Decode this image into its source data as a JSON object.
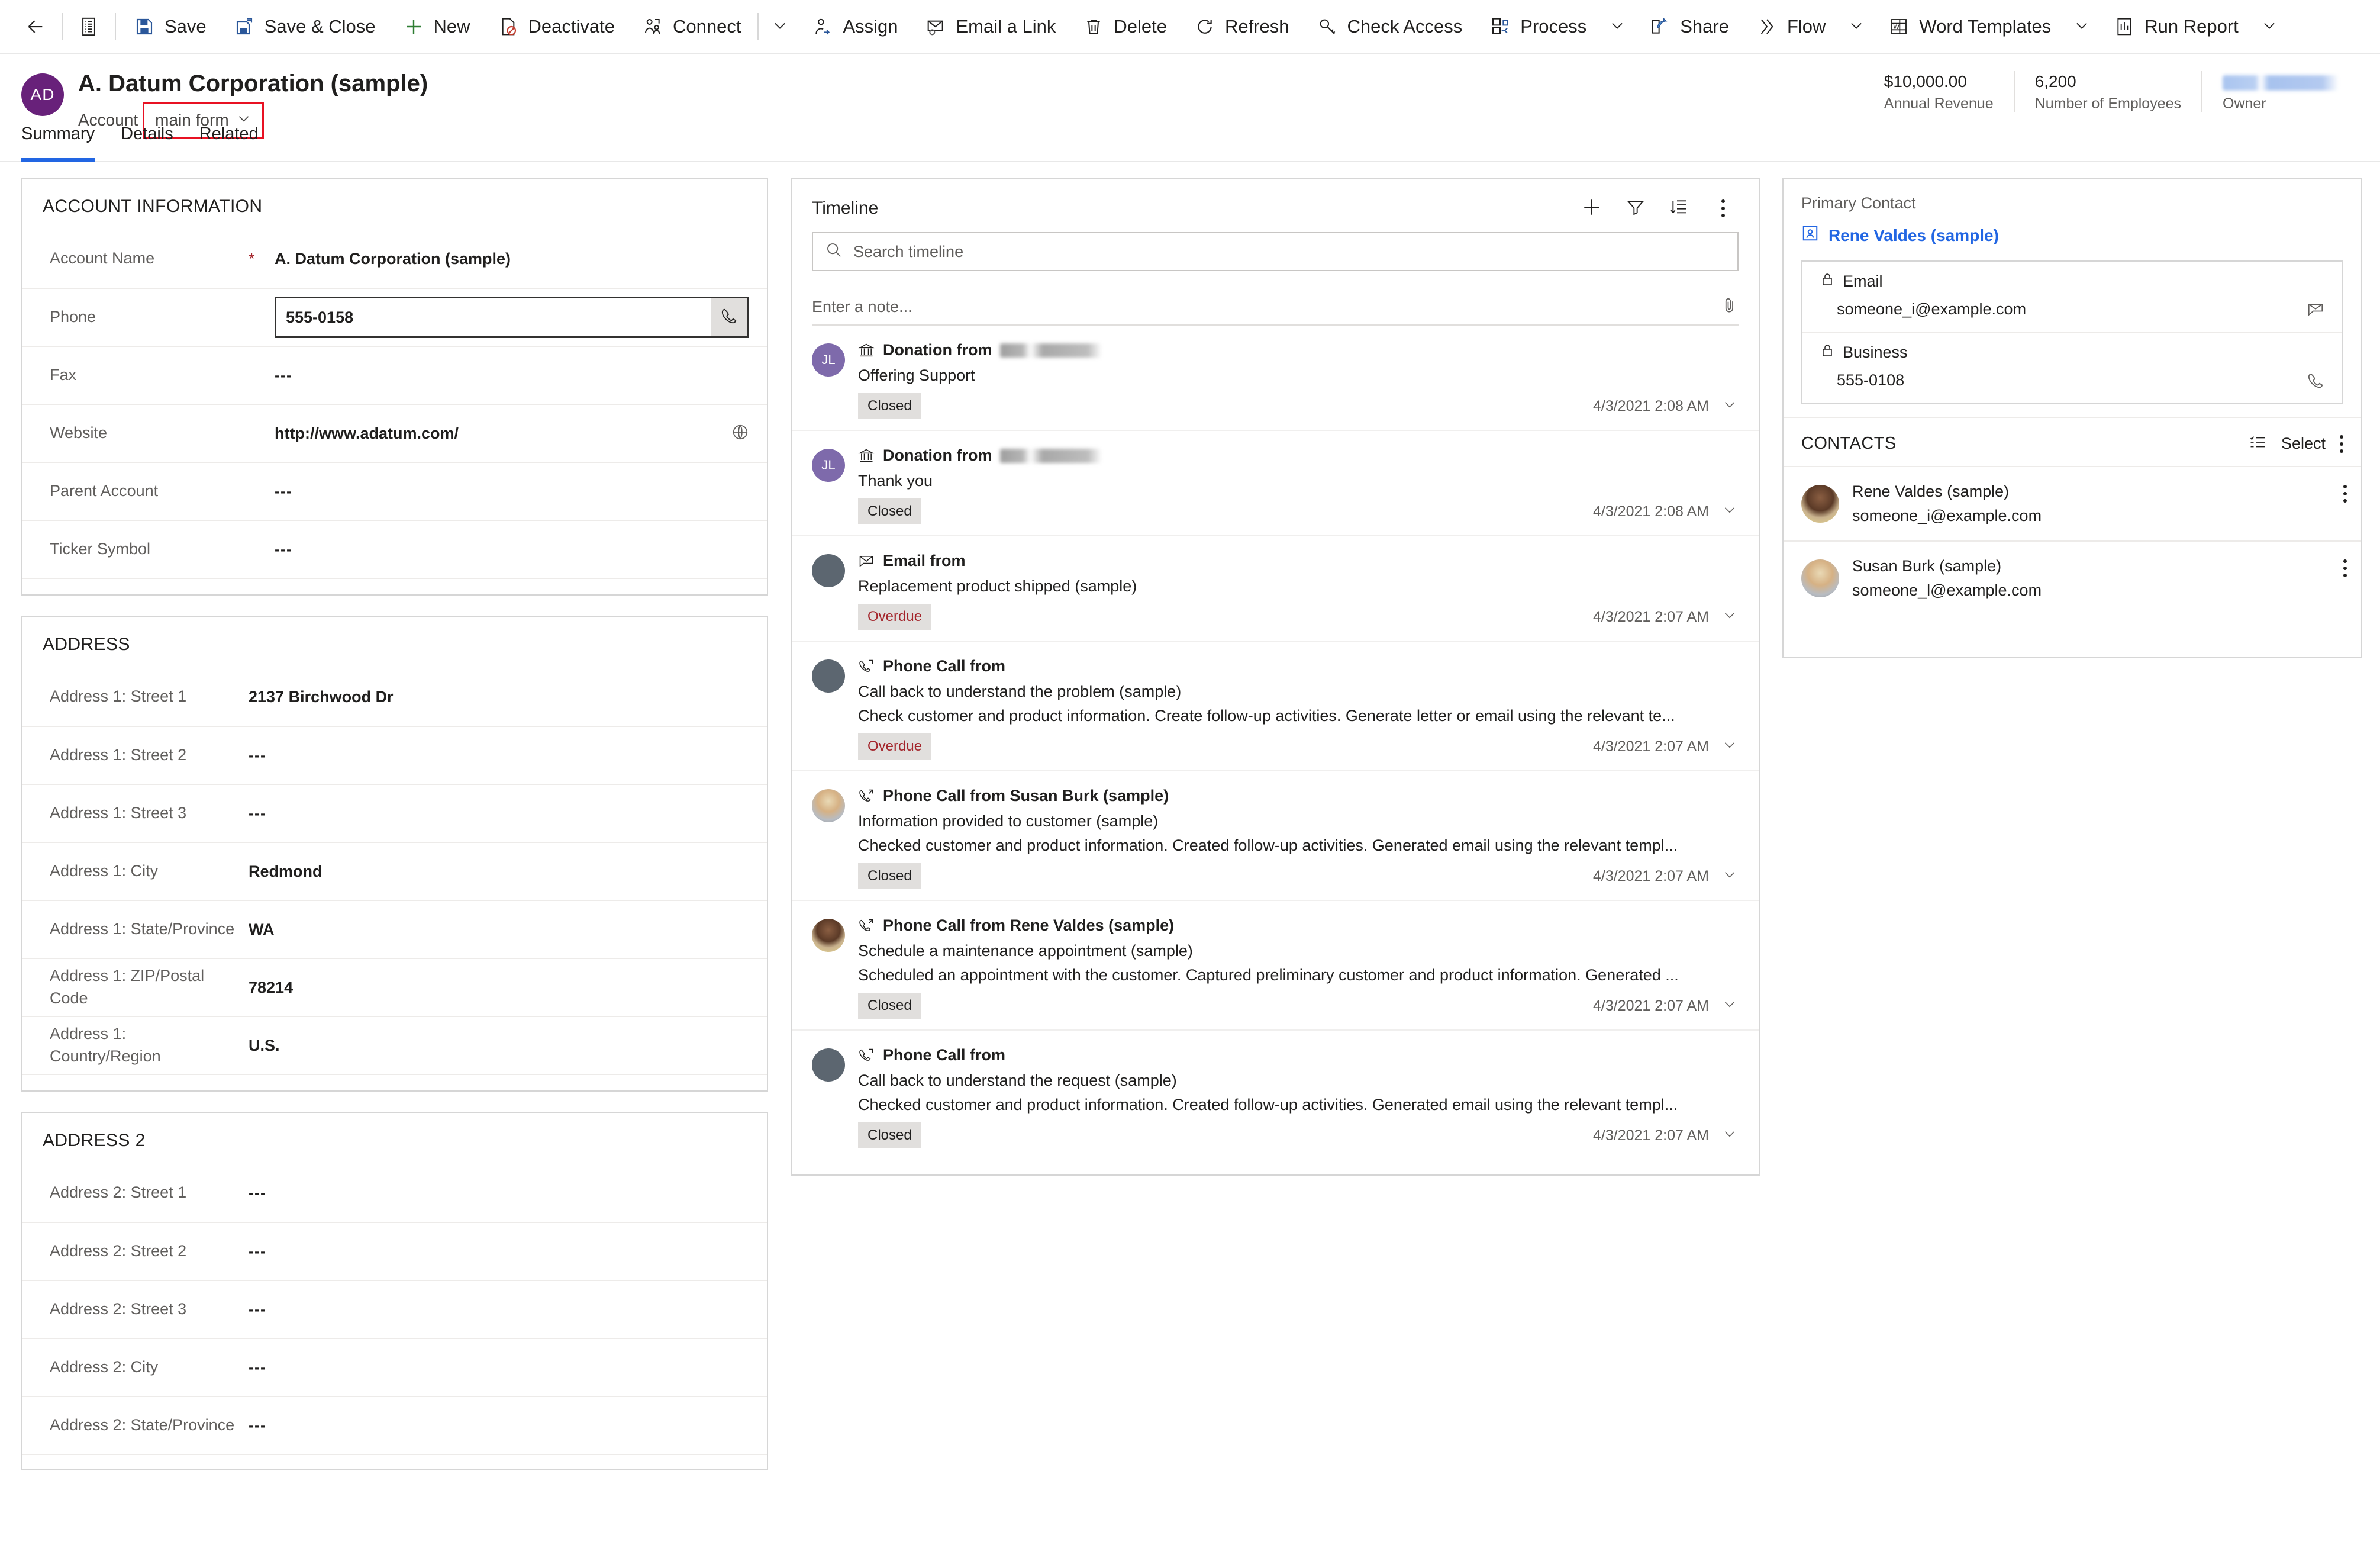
{
  "command_bar": {
    "back_label": "",
    "items": [
      {
        "label": "Save",
        "icon": "save-icon"
      },
      {
        "label": "Save & Close",
        "icon": "save-close-icon"
      },
      {
        "label": "New",
        "icon": "plus-icon"
      },
      {
        "label": "Deactivate",
        "icon": "deactivate-icon"
      },
      {
        "label": "Connect",
        "icon": "connect-icon",
        "caret": true
      },
      {
        "label": "Assign",
        "icon": "assign-icon"
      },
      {
        "label": "Email a Link",
        "icon": "email-link-icon"
      },
      {
        "label": "Delete",
        "icon": "trash-icon"
      },
      {
        "label": "Refresh",
        "icon": "refresh-icon"
      },
      {
        "label": "Check Access",
        "icon": "key-icon"
      },
      {
        "label": "Process",
        "icon": "process-icon",
        "caret": true
      },
      {
        "label": "Share",
        "icon": "share-icon"
      },
      {
        "label": "Flow",
        "icon": "flow-icon",
        "caret": true
      },
      {
        "label": "Word Templates",
        "icon": "word-icon",
        "caret": true
      },
      {
        "label": "Run Report",
        "icon": "report-icon",
        "caret": true
      }
    ]
  },
  "record_header": {
    "avatar_initials": "AD",
    "title": "A. Datum Corporation (sample)",
    "entity_label": "Account",
    "form_selector": "main form",
    "stats": [
      {
        "value": "$10,000.00",
        "label": "Annual Revenue"
      },
      {
        "value": "6,200",
        "label": "Number of Employees"
      },
      {
        "value": "",
        "label": "Owner",
        "redacted": true
      }
    ]
  },
  "tabs": [
    {
      "label": "Summary",
      "active": true
    },
    {
      "label": "Details",
      "active": false
    },
    {
      "label": "Related",
      "active": false
    }
  ],
  "account_information": {
    "title": "ACCOUNT INFORMATION",
    "fields": [
      {
        "label": "Account Name",
        "value": "A. Datum Corporation (sample)",
        "required": true
      },
      {
        "label": "Phone",
        "value": "555-0158",
        "type": "phone-input"
      },
      {
        "label": "Fax",
        "value": "---"
      },
      {
        "label": "Website",
        "value": "http://www.adatum.com/",
        "trail_icon": "globe-icon"
      },
      {
        "label": "Parent Account",
        "value": "---"
      },
      {
        "label": "Ticker Symbol",
        "value": "---"
      }
    ]
  },
  "address": {
    "title": "ADDRESS",
    "fields": [
      {
        "label": "Address 1: Street 1",
        "value": "2137 Birchwood Dr"
      },
      {
        "label": "Address 1: Street 2",
        "value": "---"
      },
      {
        "label": "Address 1: Street 3",
        "value": "---"
      },
      {
        "label": "Address 1: City",
        "value": "Redmond"
      },
      {
        "label": "Address 1: State/Province",
        "value": "WA"
      },
      {
        "label": "Address 1: ZIP/Postal Code",
        "value": "78214"
      },
      {
        "label": "Address 1: Country/Region",
        "value": "U.S."
      }
    ]
  },
  "address2": {
    "title": "ADDRESS 2",
    "fields": [
      {
        "label": "Address 2: Street 1",
        "value": "---"
      },
      {
        "label": "Address 2: Street 2",
        "value": "---"
      },
      {
        "label": "Address 2: Street 3",
        "value": "---"
      },
      {
        "label": "Address 2: City",
        "value": "---"
      },
      {
        "label": "Address 2: State/Province",
        "value": "---"
      }
    ]
  },
  "timeline": {
    "title": "Timeline",
    "search_placeholder": "Search timeline",
    "note_placeholder": "Enter a note...",
    "actions": [
      {
        "icon": "plus-icon",
        "name": "create-timeline-record"
      },
      {
        "icon": "filter-icon",
        "name": "filter-timeline"
      },
      {
        "icon": "sort-icon",
        "name": "sort-timeline"
      },
      {
        "icon": "more-icon",
        "name": "timeline-more-commands"
      }
    ],
    "items": [
      {
        "type_icon": "donation-icon",
        "header": "Donation from",
        "header_redacted": true,
        "subject": "Offering Support",
        "description": "",
        "badge": "Closed",
        "badge_state": "closed",
        "timestamp": "4/3/2021 2:08 AM",
        "avatar": {
          "kind": "initials",
          "text": "JL",
          "color": "#7E6AAB"
        }
      },
      {
        "type_icon": "donation-icon",
        "header": "Donation from",
        "header_redacted": true,
        "subject": "Thank you",
        "description": "",
        "badge": "Closed",
        "badge_state": "closed",
        "timestamp": "4/3/2021 2:08 AM",
        "avatar": {
          "kind": "initials",
          "text": "JL",
          "color": "#7E6AAB"
        }
      },
      {
        "type_icon": "email-icon",
        "header": "Email from",
        "header_redacted": false,
        "subject": "Replacement product shipped (sample)",
        "description": "",
        "badge": "Overdue",
        "badge_state": "overdue",
        "timestamp": "4/3/2021 2:07 AM",
        "avatar": {
          "kind": "blank",
          "color": "#5C6670"
        }
      },
      {
        "type_icon": "phone-icon",
        "header": "Phone Call from",
        "header_redacted": false,
        "subject": "Call back to understand the problem (sample)",
        "description": "Check customer and product information. Create follow-up activities. Generate letter or email using the relevant te...",
        "badge": "Overdue",
        "badge_state": "overdue",
        "timestamp": "4/3/2021 2:07 AM",
        "avatar": {
          "kind": "blank",
          "color": "#5C6670"
        }
      },
      {
        "type_icon": "phone-icon",
        "header": "Phone Call from Susan Burk (sample)",
        "header_redacted": false,
        "subject": "Information provided to customer (sample)",
        "description": "Checked customer and product information. Created follow-up activities. Generated email using the relevant templ...",
        "badge": "Closed",
        "badge_state": "closed",
        "timestamp": "4/3/2021 2:07 AM",
        "avatar": {
          "kind": "photo",
          "variant": 2
        }
      },
      {
        "type_icon": "phone-icon",
        "header": "Phone Call from Rene Valdes (sample)",
        "header_redacted": false,
        "subject": "Schedule a maintenance appointment (sample)",
        "description": "Scheduled an appointment with the customer. Captured preliminary customer and product information. Generated ...",
        "badge": "Closed",
        "badge_state": "closed",
        "timestamp": "4/3/2021 2:07 AM",
        "avatar": {
          "kind": "photo",
          "variant": 1
        }
      },
      {
        "type_icon": "phone-icon",
        "header": "Phone Call from",
        "header_redacted": false,
        "subject": "Call back to understand the request (sample)",
        "description": "Checked customer and product information. Created follow-up activities. Generated email using the relevant templ...",
        "badge": "Closed",
        "badge_state": "closed",
        "timestamp": "4/3/2021 2:07 AM",
        "avatar": {
          "kind": "blank",
          "color": "#5C6670"
        }
      }
    ]
  },
  "primary_contact": {
    "label": "Primary Contact",
    "name": "Rene Valdes (sample)",
    "email_label": "Email",
    "email_value": "someone_i@example.com",
    "business_label": "Business",
    "business_value": "555-0108"
  },
  "contacts": {
    "title": "CONTACTS",
    "select_label": "Select",
    "items": [
      {
        "name": "Rene Valdes (sample)",
        "email": "someone_i@example.com",
        "avatar_variant": 1
      },
      {
        "name": "Susan Burk (sample)",
        "email": "someone_l@example.com",
        "avatar_variant": 2
      }
    ]
  },
  "colors": {
    "accent": "#2266E3",
    "brand_purple": "#68217A",
    "annotation_red": "#e81123",
    "overdue_red": "#a4262c"
  }
}
